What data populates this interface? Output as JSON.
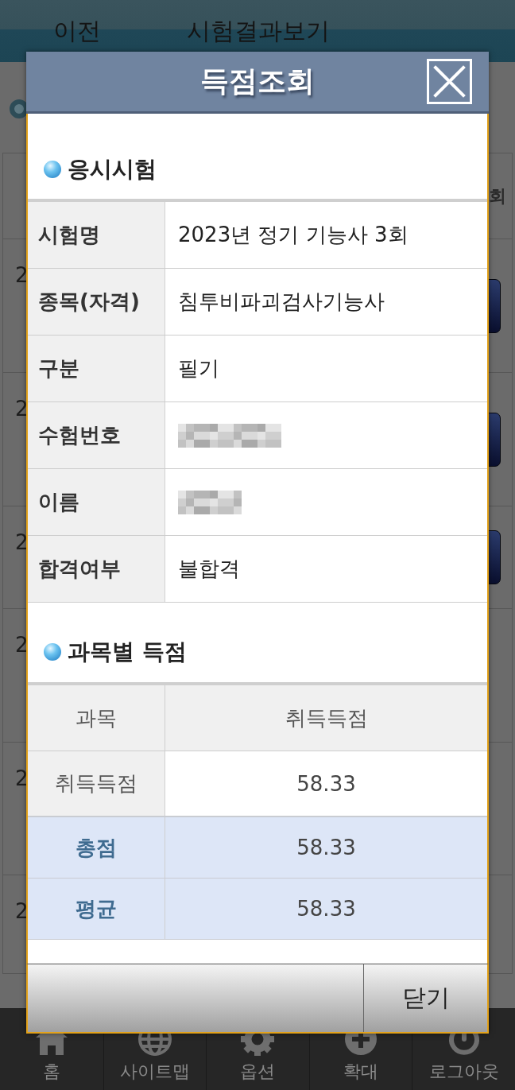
{
  "page": {
    "header": {
      "back_button": "이전",
      "title": "시험결과보기"
    },
    "result_list": {
      "column_header": "회",
      "rows": [
        {
          "column_1": "2",
          "kind": "button"
        },
        {
          "column_1": "2",
          "kind": "button"
        },
        {
          "column_1": "2",
          "kind": "button"
        },
        {
          "column_1": "2",
          "kind": "plain"
        },
        {
          "column_1": "2",
          "kind": "plain"
        },
        {
          "column_1": "2",
          "kind": "plain"
        }
      ]
    },
    "bottom_nav": [
      "홈",
      "사이트맵",
      "옵션",
      "확대",
      "로그아웃"
    ]
  },
  "dialog": {
    "title": "득점조회",
    "exam_section": {
      "heading": "응시시험",
      "rows": [
        {
          "label": "시험명",
          "value": "2023년 정기 기능사 3회",
          "kind": "text"
        },
        {
          "label": "종목(자격)",
          "value": "침투비파괴검사기능사",
          "kind": "text"
        },
        {
          "label": "구분",
          "value": "필기",
          "kind": "text"
        },
        {
          "label": "수험번호",
          "kind": "masked"
        },
        {
          "label": "이름",
          "kind": "masked"
        },
        {
          "label": "합격여부",
          "value": "불합격",
          "kind": "text"
        }
      ]
    },
    "score_section": {
      "heading": "과목별 득점",
      "columns": [
        "과목",
        "취득득점"
      ],
      "rows": [
        {
          "label": "취득득점",
          "value": "58.33",
          "kind": "subject"
        },
        {
          "label": "총점",
          "value": "58.33",
          "kind": "summary"
        },
        {
          "label": "평균",
          "value": "58.33",
          "kind": "summary"
        }
      ]
    },
    "footer_buttons": [
      "닫기"
    ]
  }
}
